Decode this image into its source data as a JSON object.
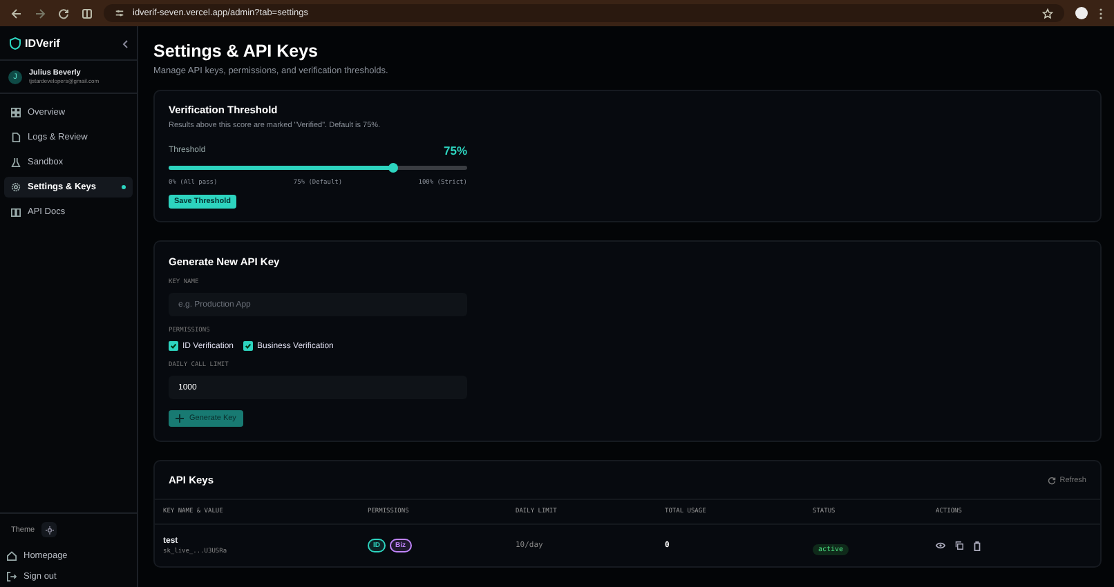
{
  "browser": {
    "url": "idverif-seven.vercel.app/admin?tab=settings"
  },
  "sidebar": {
    "brand": "IDVerif",
    "user": {
      "initial": "J",
      "name": "Julius Beverly",
      "email": "tjstardevelopers@gmail.com"
    },
    "nav": [
      {
        "label": "Overview",
        "selected": false
      },
      {
        "label": "Logs & Review",
        "selected": false
      },
      {
        "label": "Sandbox",
        "selected": false
      },
      {
        "label": "Settings & Keys",
        "selected": true
      },
      {
        "label": "API Docs",
        "selected": false
      }
    ],
    "theme_label": "Theme",
    "footer": [
      {
        "label": "Homepage"
      },
      {
        "label": "Sign out"
      }
    ]
  },
  "page": {
    "title": "Settings & API Keys",
    "subtitle": "Manage API keys, permissions, and verification thresholds."
  },
  "threshold": {
    "title": "Verification Threshold",
    "description": "Results above this score are marked \"Verified\". Default is 75%.",
    "label": "Threshold",
    "value": "75%",
    "level": 0.75,
    "ticks": [
      "0% (All pass)",
      "75% (Default)",
      "100% (Strict)"
    ],
    "button": "Save Threshold"
  },
  "generate": {
    "title": "Generate New API Key",
    "key_name_label": "KEY NAME",
    "key_name_placeholder": "e.g. Production App",
    "permissions_label": "PERMISSIONS",
    "permissions": [
      {
        "label": "ID Verification",
        "checked": true
      },
      {
        "label": "Business Verification",
        "checked": true
      }
    ],
    "limit_label": "DAILY CALL LIMIT",
    "limit_value": "1000",
    "button": "Generate Key",
    "button_disabled": true
  },
  "api_keys": {
    "title": "API Keys",
    "refresh": "Refresh",
    "columns": [
      "KEY NAME & VALUE",
      "PERMISSIONS",
      "DAILY LIMIT",
      "TOTAL USAGE",
      "STATUS",
      "ACTIONS"
    ],
    "rows": [
      {
        "name": "test",
        "key": "sk_live_...U3USRa",
        "permissions": [
          {
            "label": "ID",
            "color": "#2dd4bf"
          },
          {
            "label": "Biz",
            "color": "#c084fc"
          }
        ],
        "daily_limit": "10/day",
        "total_usage": "0",
        "status": "active"
      }
    ]
  }
}
